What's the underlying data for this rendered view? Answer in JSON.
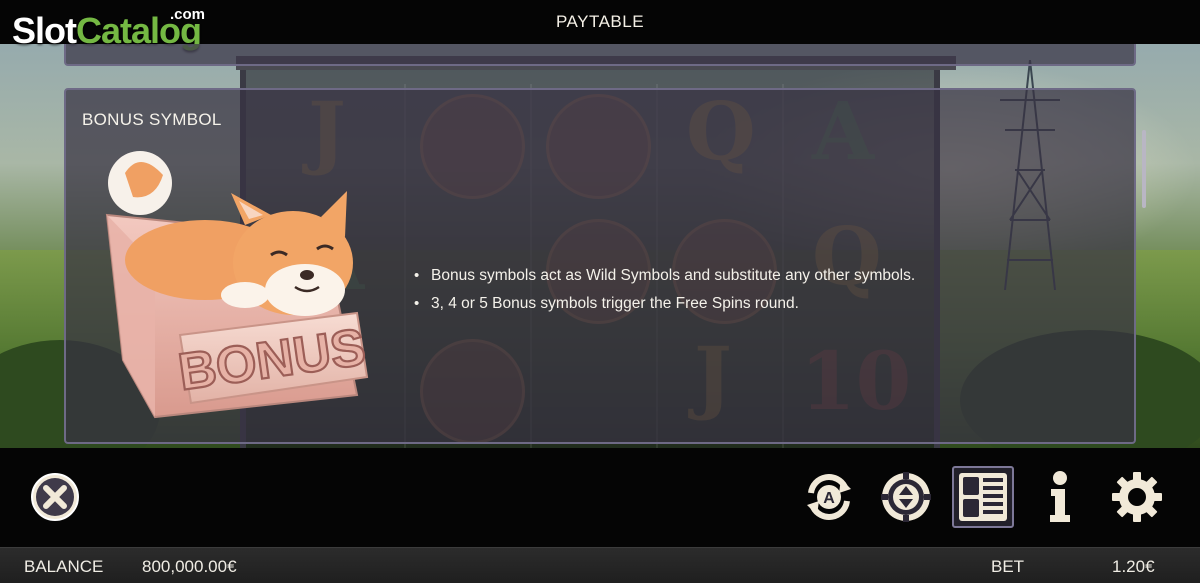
{
  "brand": {
    "slot": "Slot",
    "catalog": "Catalog",
    "dotcom": ".com"
  },
  "header": {
    "title": "PAYTABLE"
  },
  "section": {
    "heading": "BONUS SYMBOL",
    "symbol_label": "BONUS",
    "rules": [
      "Bonus symbols act as Wild Symbols and substitute any other symbols.",
      "3, 4 or 5 Bonus symbols trigger the Free Spins round."
    ]
  },
  "toolbar": {
    "close": "close-icon",
    "buttons": [
      "autoplay-icon",
      "bet-chip-icon",
      "paytable-icon",
      "info-icon",
      "settings-icon"
    ],
    "selected": "paytable-icon"
  },
  "status": {
    "balance_label": "BALANCE",
    "balance_value": "800,000.00€",
    "bet_label": "BET",
    "bet_value": "1.20€"
  },
  "colors": {
    "panel_bg": "#3a3444",
    "panel_border": "#6e6a86",
    "icon_fill": "#f1e9d8",
    "brand_green": "#74b843"
  }
}
